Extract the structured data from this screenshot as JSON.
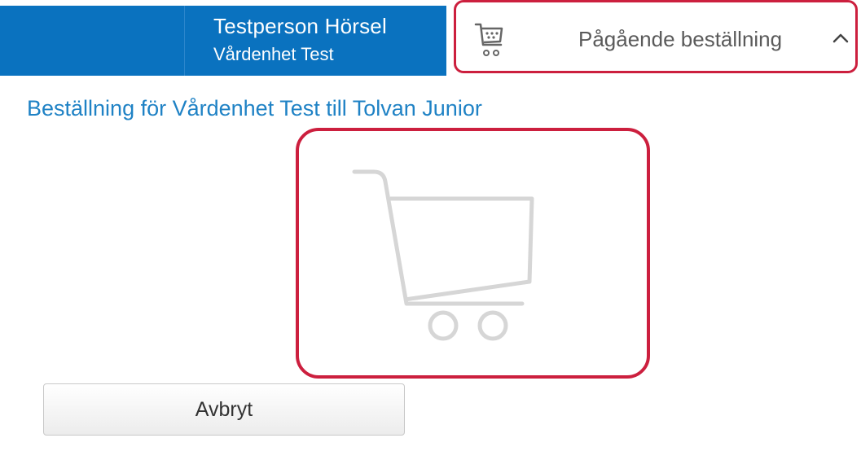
{
  "header": {
    "user_name": "Testperson Hörsel",
    "user_unit": "Vårdenhet Test",
    "cart_label": "Pågående beställning",
    "cart_icon": "shopping-cart-icon",
    "toggle_icon": "chevron-up-icon"
  },
  "main": {
    "order_title": "Beställning för Vårdenhet Test till Tolvan Junior",
    "empty_cart_icon": "empty-cart-icon",
    "cancel_label": "Avbryt"
  },
  "colors": {
    "header_blue": "#0a72bf",
    "highlight_red": "#cc1f3e",
    "link_blue": "#1f82c5",
    "icon_gray": "#d6d6d6"
  }
}
